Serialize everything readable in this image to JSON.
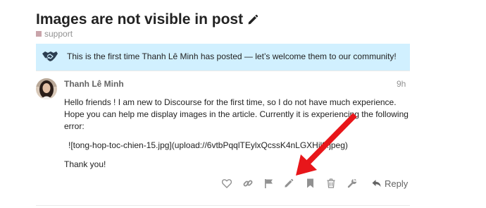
{
  "topic": {
    "title": "Images are not visible in post",
    "category": "support"
  },
  "banner": {
    "text": "This is the first time Thanh Lê Minh has posted — let’s welcome them to our community!"
  },
  "post": {
    "username": "Thanh Lê Minh",
    "time": "9h",
    "paragraphs": [
      "Hello friends ! I am new to Discourse for the first time, so I do not have much experience. Hope you can help me display images in the article. Currently it is experiencing the following error:",
      "![tong-hop-toc-chien-15.jpg](upload://6vtbPqqlTEylxQcssK4nLGXHjl8.jpeg)",
      "Thank you!"
    ]
  },
  "actions": {
    "icons": [
      "heart-icon",
      "link-icon",
      "flag-icon",
      "pencil-icon",
      "bookmark-icon",
      "trash-icon",
      "wrench-icon",
      "reply-icon"
    ],
    "reply_label": "Reply"
  },
  "colors": {
    "banner_bg": "#d1f0ff",
    "category": "#c9a4aa",
    "muted": "#919191",
    "annotation_arrow": "#e8161a"
  }
}
